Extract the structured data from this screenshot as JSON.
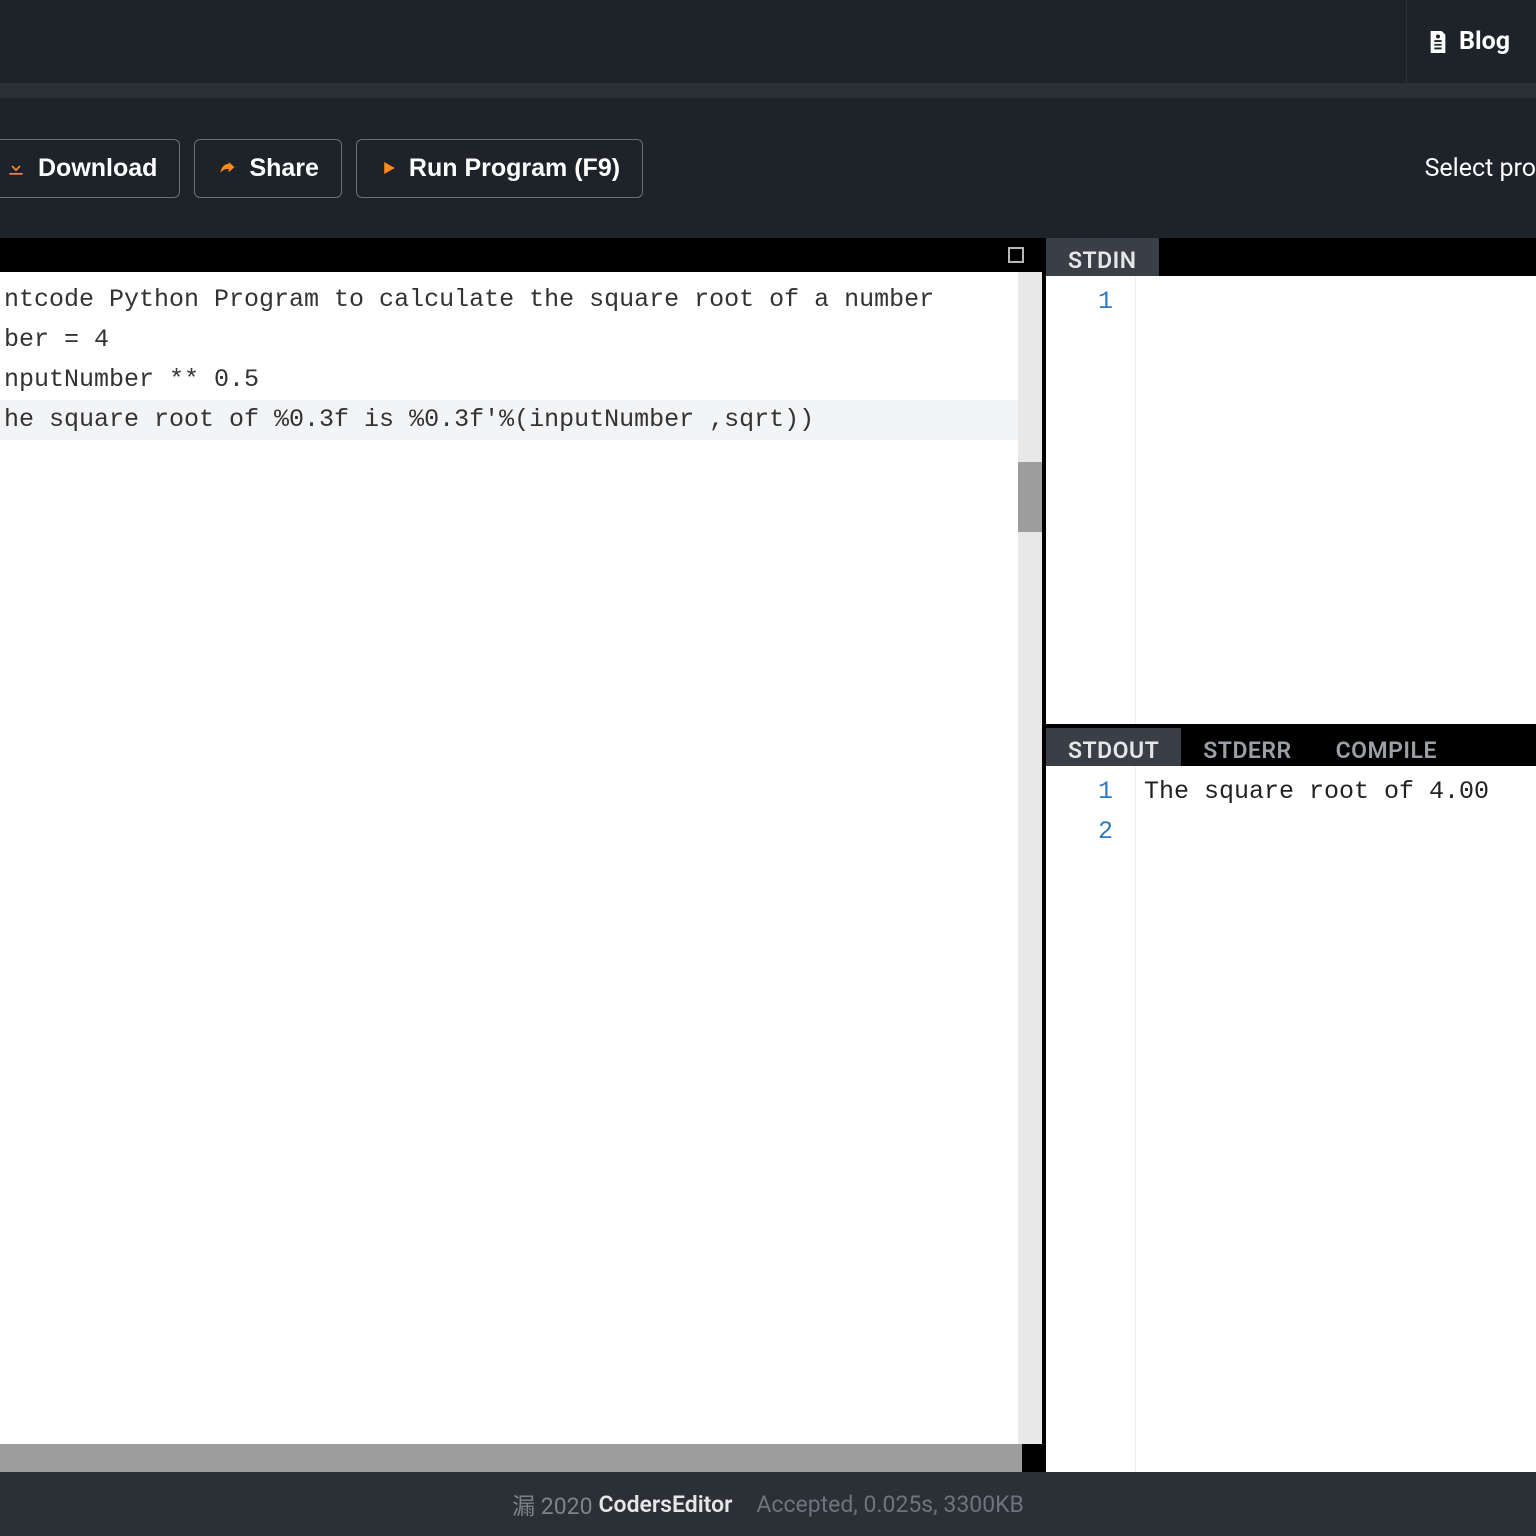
{
  "nav": {
    "blog": "Blog"
  },
  "toolbar": {
    "download": "Download",
    "share": "Share",
    "run": "Run Program (F9)",
    "select": "Select pro"
  },
  "editor": {
    "lines": [
      "ntcode Python Program to calculate the square root of a number",
      "",
      "ber = 4",
      "",
      "nputNumber ** 0.5",
      "",
      "he square root of %0.3f is %0.3f'%(inputNumber ,sqrt))"
    ],
    "highlight_index": 6
  },
  "stdin": {
    "tab": "STDIN",
    "gutter": [
      "1"
    ],
    "content": [
      ""
    ]
  },
  "stdout": {
    "tabs": [
      "STDOUT",
      "STDERR",
      "COMPILE"
    ],
    "active_tab": 0,
    "gutter": [
      "1",
      "2"
    ],
    "content": [
      "The square root of 4.00",
      ""
    ]
  },
  "footer": {
    "copyright_prefix": "漏 2020",
    "brand": "CodersEditor",
    "status": "Accepted, 0.025s, 3300KB"
  }
}
